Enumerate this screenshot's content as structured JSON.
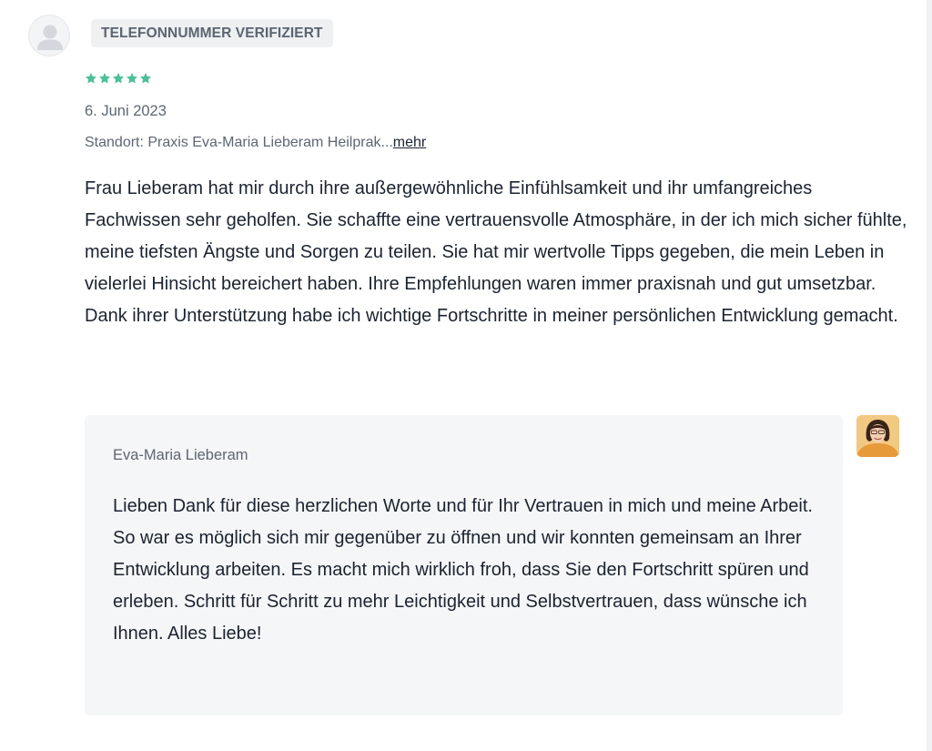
{
  "reviewer": {
    "avatar_icon": "user-placeholder-icon",
    "badge_label": "TELEFONNUMMER VERIFIZIERT"
  },
  "rating": {
    "stars": 5,
    "max_stars": 5,
    "star_color": "#4dbf99"
  },
  "review": {
    "date": "6. Juni 2023",
    "location_text": "Standort: Praxis Eva-Maria Lieberam Heilprak...",
    "more_link": "mehr",
    "body": "Frau Lieberam hat mir durch ihre außergewöhnliche Einfühlsamkeit und ihr umfangreiches Fachwissen sehr geholfen. Sie schaffte eine vertrauensvolle Atmosphäre, in der ich mich sicher fühlte, meine tiefsten Ängste und Sorgen zu teilen. Sie hat mir wertvolle Tipps gegeben, die mein Leben in vielerlei Hinsicht bereichert haben. Ihre Empfehlungen waren immer praxisnah und gut umsetzbar. Dank ihrer Unterstützung habe ich wichtige Fortschritte in meiner persönlichen Entwicklung gemacht."
  },
  "reply": {
    "author": "Eva-Maria Lieberam",
    "body": "Lieben Dank für diese herzlichen Worte und für Ihr Vertrauen in mich und meine Arbeit. So war es möglich sich mir gegenüber zu öffnen und wir konnten gemeinsam an Ihrer Entwicklung arbeiten. Es macht mich wirklich froh, dass Sie den Fortschritt spüren und erleben. Schritt für Schritt zu mehr Leichtigkeit und Selbstvertrauen, dass wünsche ich Ihnen. Alles Liebe!",
    "avatar_icon": "owner-photo-icon"
  }
}
